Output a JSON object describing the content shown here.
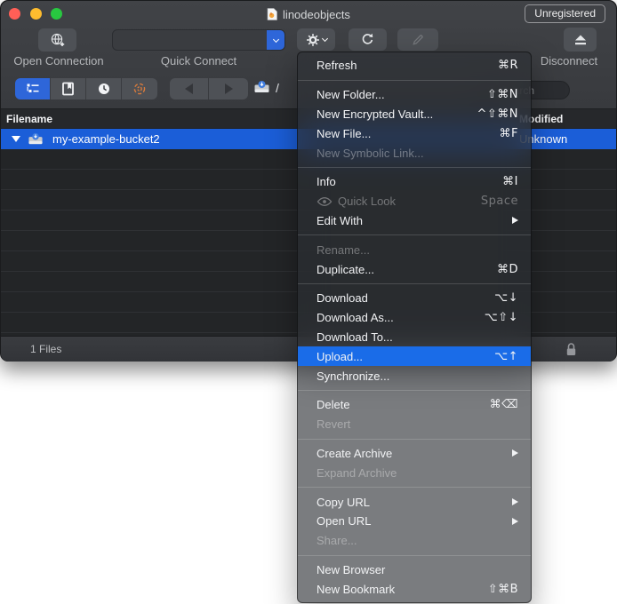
{
  "window": {
    "title": "linodeobjects",
    "badge": "Unregistered"
  },
  "toolbar": {
    "open_connection_label": "Open Connection",
    "quick_connect_label": "Quick Connect",
    "quick_connect_value": "",
    "disconnect_label": "Disconnect"
  },
  "navbar": {
    "path": "/",
    "search_placeholder": "Search"
  },
  "table": {
    "columns": [
      "Filename",
      "Modified"
    ],
    "rows": [
      {
        "name": "my-example-bucket2",
        "modified": "Unknown",
        "selected": true
      }
    ]
  },
  "statusbar": {
    "files_count": "1 Files"
  },
  "menu": {
    "items": [
      {
        "label": "Refresh",
        "shortcut": "⌘R"
      },
      {
        "label": "New Folder...",
        "shortcut": "⇧⌘N"
      },
      {
        "label": "New Encrypted Vault...",
        "shortcut": "^⇧⌘N"
      },
      {
        "label": "New File...",
        "shortcut": "⌘F"
      },
      {
        "label": "New Symbolic Link...",
        "shortcut": "",
        "state": "disabled"
      },
      {
        "label": "Info",
        "shortcut": "⌘I"
      },
      {
        "label": "Quick Look",
        "shortcut": "Space",
        "state": "disabled",
        "icon": "eye-icon"
      },
      {
        "label": "Edit With",
        "submenu": true
      },
      {
        "label": "Rename...",
        "shortcut": "",
        "state": "disabled"
      },
      {
        "label": "Duplicate...",
        "shortcut": "⌘D"
      },
      {
        "label": "Download",
        "shortcut": "⌥↓"
      },
      {
        "label": "Download As...",
        "shortcut": "⌥⇧↓"
      },
      {
        "label": "Download To...",
        "shortcut": ""
      },
      {
        "label": "Upload...",
        "shortcut": "⌥↑",
        "highlighted": true
      },
      {
        "label": "Synchronize...",
        "shortcut": ""
      },
      {
        "label": "Delete",
        "shortcut": "⌘⌫"
      },
      {
        "label": "Revert",
        "shortcut": "",
        "state": "disabled"
      },
      {
        "label": "Create Archive",
        "submenu": true
      },
      {
        "label": "Expand Archive",
        "shortcut": "",
        "state": "disabled"
      },
      {
        "label": "Copy URL",
        "submenu": true
      },
      {
        "label": "Open URL",
        "submenu": true
      },
      {
        "label": "Share...",
        "shortcut": "",
        "state": "disabled"
      },
      {
        "label": "New Browser",
        "shortcut": ""
      },
      {
        "label": "New Bookmark",
        "shortcut": "⇧⌘B"
      }
    ]
  },
  "colors": {
    "selection_blue": "#1b5ed8",
    "menu_highlight_blue": "#1a6ce8",
    "segment_accent_blue": "#2e66d9",
    "traffic_red": "#ff5f57",
    "traffic_yellow": "#febc2e",
    "traffic_green": "#28c840"
  }
}
